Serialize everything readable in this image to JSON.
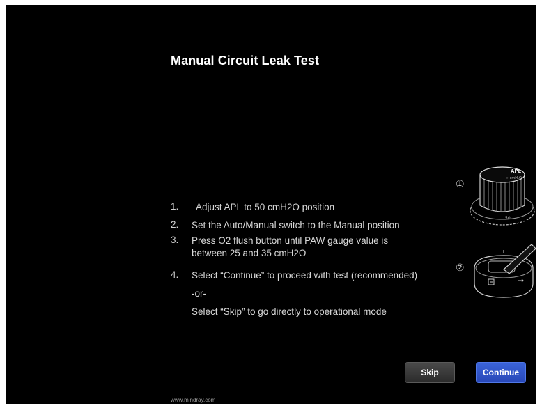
{
  "title": "Manual Circuit Leak Test",
  "steps": [
    {
      "num": "1.",
      "text": "Adjust APL to 50 cmH2O position"
    },
    {
      "num": "2.",
      "text": "Set the Auto/Manual switch to the Manual position"
    },
    {
      "num": "3.",
      "text": "Press O2 flush button until PAW gauge value is",
      "text2": "between 25 and 35 cmH2O"
    },
    {
      "num": "4.",
      "text": "Select “Continue” to proceed with test (recommended)"
    }
  ],
  "or_text": "-or-",
  "skip_text": "Select “Skip” to go directly to operational mode",
  "illustrations": {
    "apl_marker": "①",
    "apl_label": "APL",
    "apl_sub": "» cmH₂O",
    "apl_scale": "50",
    "switch_marker": "②"
  },
  "buttons": {
    "skip": "Skip",
    "continue": "Continue"
  },
  "footer": "www.mindray.com",
  "colors": {
    "background": "#000000",
    "continue_button": "#2f55c8",
    "skip_button": "#3a3a3a"
  }
}
